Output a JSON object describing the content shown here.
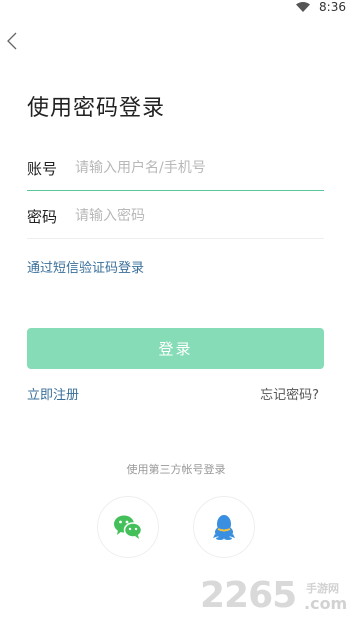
{
  "status_bar": {
    "time": "8:36",
    "wifi_icon": "wifi-icon"
  },
  "nav": {
    "back_icon": "chevron-left-icon"
  },
  "page": {
    "title": "使用密码登录"
  },
  "form": {
    "account_label": "账号",
    "account_placeholder": "请输入用户名/手机号",
    "account_value": "",
    "password_label": "密码",
    "password_placeholder": "请输入密码",
    "password_value": ""
  },
  "links": {
    "sms_login": "通过短信验证码登录",
    "register": "立即注册",
    "forgot_password": "忘记密码?"
  },
  "login_button": {
    "label": "登录",
    "color": "#86dcb7"
  },
  "third_party": {
    "label": "使用第三方帐号登录",
    "options": [
      {
        "icon": "wechat-icon",
        "color": "#44c05a"
      },
      {
        "icon": "qq-icon",
        "color": "#3b8fe0"
      }
    ]
  },
  "watermark": {
    "number": "2265",
    "cn": "手游网",
    "domain": ".com"
  },
  "colors": {
    "accent": "#5cc89a",
    "link": "#3a6f9a"
  }
}
